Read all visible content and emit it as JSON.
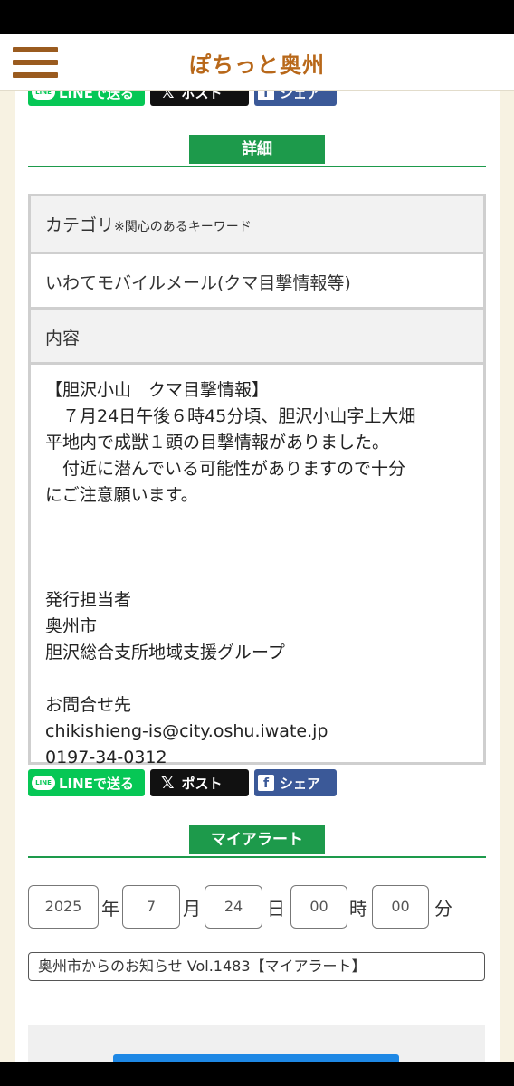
{
  "header": {
    "title": "ぽちっと奥州"
  },
  "share": {
    "line_label": "LINEで送る",
    "x_label": "ポスト",
    "fb_label": "シェア",
    "line_logo_text": "LINE",
    "x_logo": "𝕏",
    "fb_logo": "f"
  },
  "details": {
    "heading": "詳細",
    "category_label": "カテゴリ",
    "category_note": "※関心のあるキーワード",
    "category_value": "いわてモバイルメール(クマ目撃情報等)",
    "content_label": "内容",
    "content_lines": [
      "【胆沢小山　クマ目撃情報】",
      "　７月24日午後６時45分頃、胆沢小山字上大畑",
      "平地内で成獣１頭の目撃情報がありました。",
      "　付近に潜んでいる可能性がありますので十分",
      "にご注意願います。",
      "",
      "",
      "",
      "発行担当者",
      "奥州市",
      "胆沢総合支所地域支援グループ",
      "",
      "お問合せ先",
      "chikishieng-is@city.oshu.iwate.jp",
      "0197-34-0312"
    ]
  },
  "my_alert": {
    "heading": "マイアラート",
    "year": "2025",
    "year_unit": "年",
    "month": "7",
    "month_unit": "月",
    "day": "24",
    "day_unit": "日",
    "hour": "00",
    "hour_unit": "時",
    "minute": "00",
    "minute_unit": "分",
    "selected": "奥州市からのお知らせ Vol.1483【マイアラート】"
  }
}
